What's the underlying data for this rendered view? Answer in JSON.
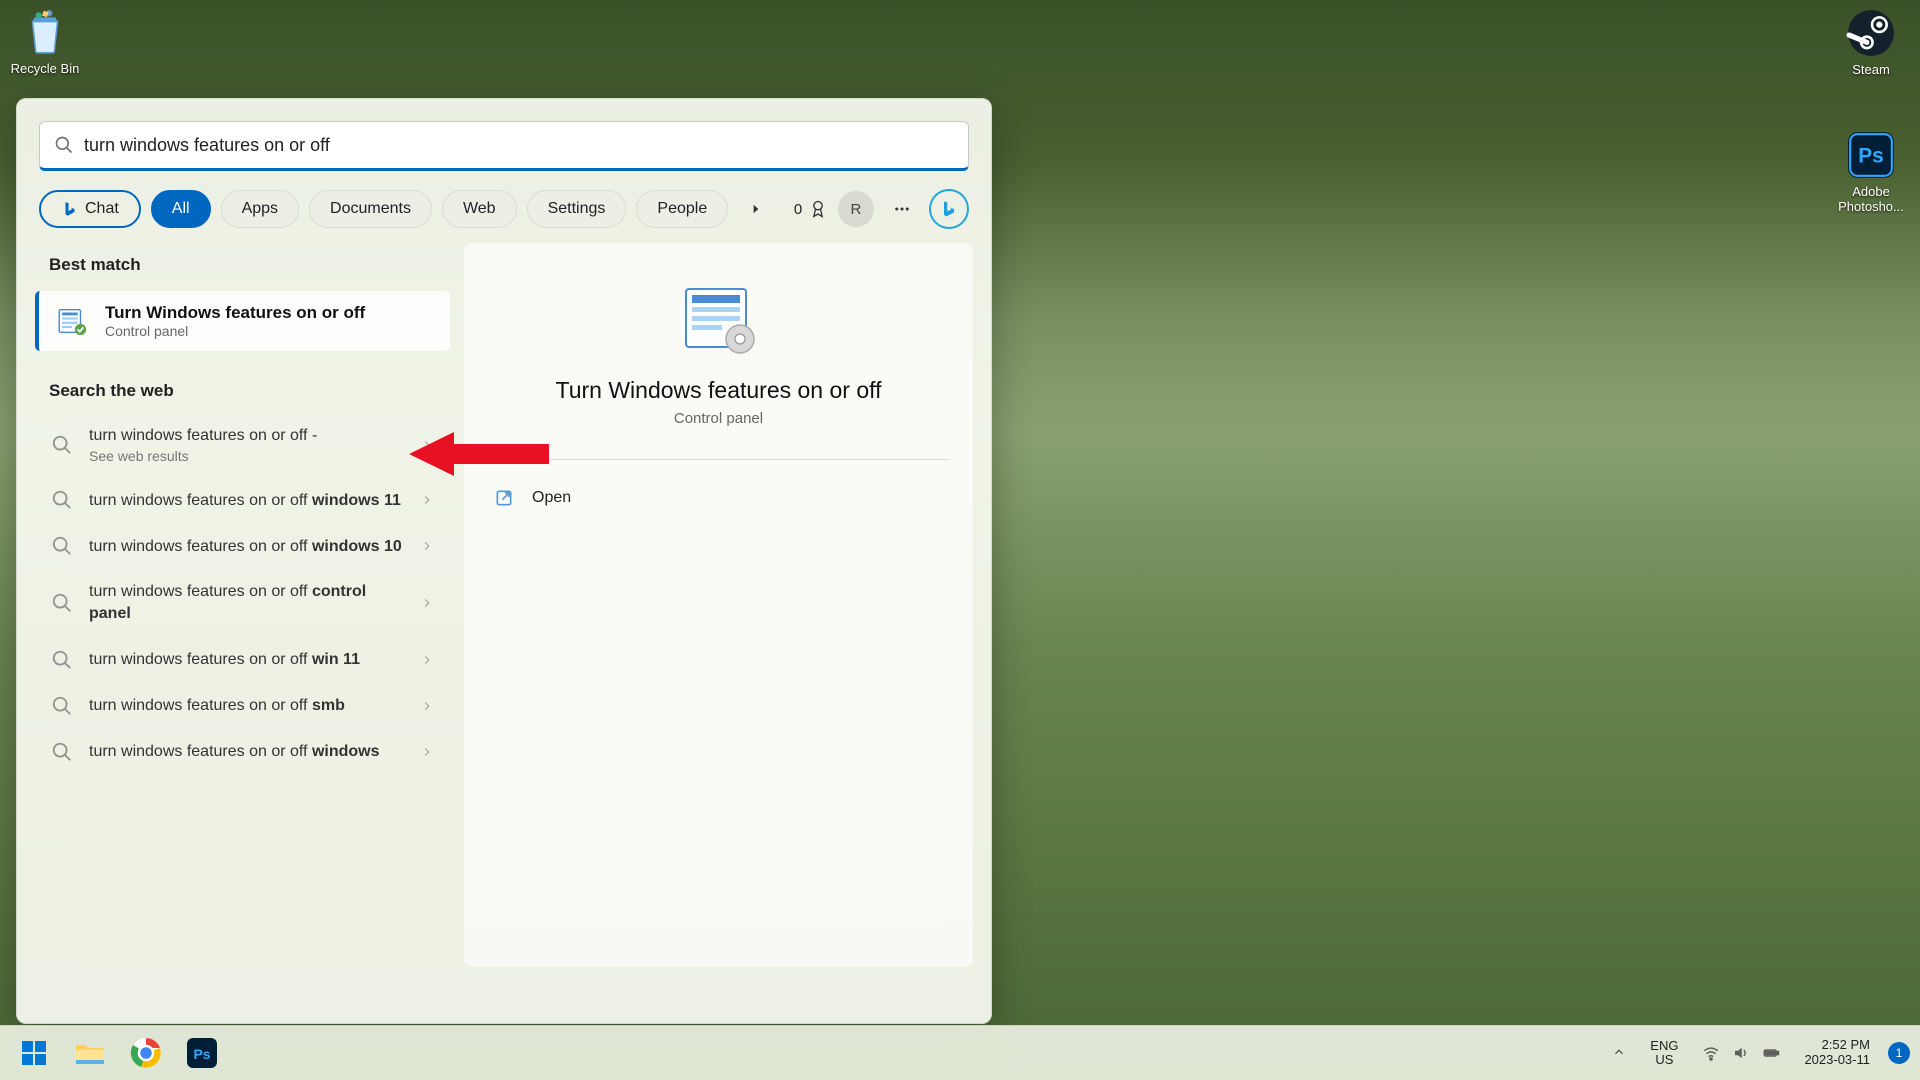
{
  "desktop": {
    "icons": {
      "recycle_bin": "Recycle Bin",
      "steam": "Steam",
      "photoshop": "Adobe Photosho..."
    }
  },
  "search": {
    "query": "turn windows features on or off",
    "filters": {
      "chat": "Chat",
      "all": "All",
      "apps": "Apps",
      "documents": "Documents",
      "web": "Web",
      "settings": "Settings",
      "people": "People"
    },
    "rewards_count": "0",
    "user_initial": "R",
    "sections": {
      "best_match_label": "Best match",
      "web_label": "Search the web"
    },
    "best_match": {
      "title": "Turn Windows features on or off",
      "subtitle": "Control panel"
    },
    "web_results": [
      {
        "prefix": "turn windows features on or off -",
        "bold": "",
        "sub": "See web results"
      },
      {
        "prefix": "turn windows features on or off ",
        "bold": "windows 11",
        "sub": ""
      },
      {
        "prefix": "turn windows features on or off ",
        "bold": "windows 10",
        "sub": ""
      },
      {
        "prefix": "turn windows features on or off ",
        "bold": "control panel",
        "sub": ""
      },
      {
        "prefix": "turn windows features on or off ",
        "bold": "win 11",
        "sub": ""
      },
      {
        "prefix": "turn windows features on or off ",
        "bold": "smb",
        "sub": ""
      },
      {
        "prefix": "turn windows features on or off ",
        "bold": "windows",
        "sub": ""
      }
    ],
    "preview": {
      "title": "Turn Windows features on or off",
      "subtitle": "Control panel",
      "open_label": "Open"
    }
  },
  "taskbar": {
    "lang_top": "ENG",
    "lang_bottom": "US",
    "time": "2:52 PM",
    "date": "2023-03-11",
    "notif_count": "1"
  }
}
